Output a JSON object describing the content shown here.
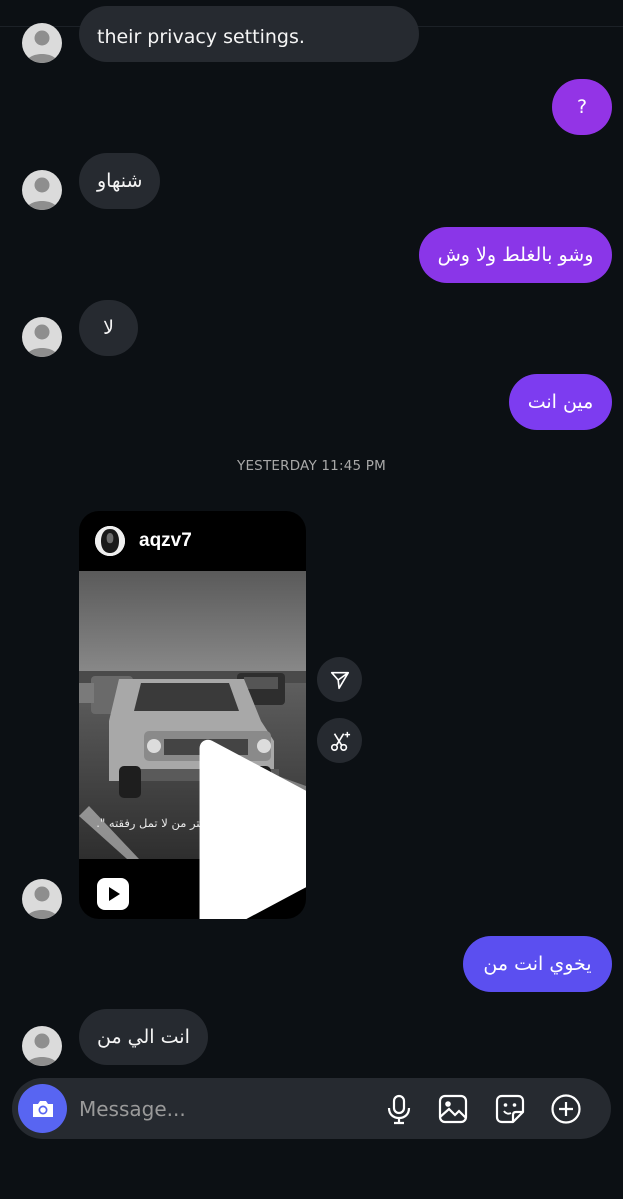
{
  "messages": {
    "m1": "their privacy settings.",
    "m2": "?",
    "m3": "شنهاو",
    "m4": "وشو بالغلط ولا وش",
    "m5": "لا",
    "m6": "مين انت",
    "timestamp": "YESTERDAY 11:45 PM",
    "m8": "يخوي انت من",
    "m9": "انت الي من"
  },
  "reel": {
    "username": "aqzv7",
    "caption": "\" الطريق طويل إختر من لا تمل رفقته \"."
  },
  "composer": {
    "placeholder": "Message...",
    "icons": [
      "camera-icon",
      "microphone-icon",
      "gallery-icon",
      "sticker-icon",
      "plus-icon"
    ]
  },
  "colors": {
    "background": "#0c1014",
    "incoming_bubble": "#262a30",
    "outgoing_purple": "#9334e6",
    "outgoing_violet": "#7d3cf0",
    "outgoing_indigo": "#5b4ff0",
    "camera_button": "#5865f2"
  }
}
